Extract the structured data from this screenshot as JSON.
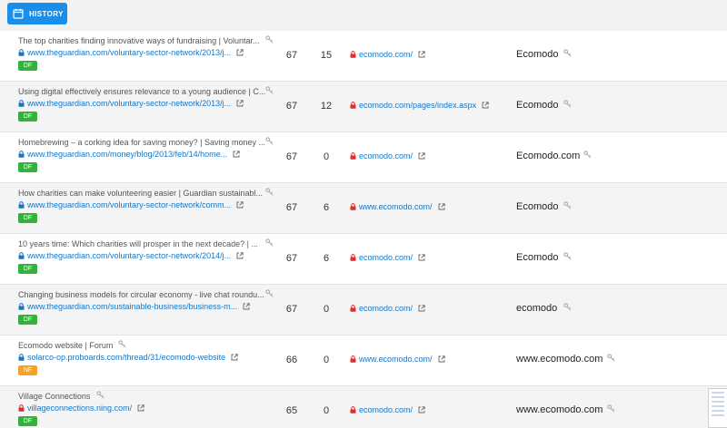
{
  "toolbar": {
    "history_label": "HISTORY"
  },
  "rows": [
    {
      "title": "The top charities finding innovative ways of fundraising | Voluntar...",
      "url": "www.theguardian.com/voluntary-sector-network/2013/j...",
      "badge": "DF",
      "n1": "67",
      "n2": "15",
      "target": "ecomodo.com/",
      "anchor": "Ecomodo"
    },
    {
      "title": "Using digital effectively ensures relevance to a young audience | C...",
      "url": "www.theguardian.com/voluntary-sector-network/2013/j...",
      "badge": "DF",
      "n1": "67",
      "n2": "12",
      "target": "ecomodo.com/pages/index.aspx",
      "anchor": "Ecomodo"
    },
    {
      "title": "Homebrewing – a corking idea for saving money? | Saving money ...",
      "url": "www.theguardian.com/money/blog/2013/feb/14/home...",
      "badge": "DF",
      "n1": "67",
      "n2": "0",
      "target": "ecomodo.com/",
      "anchor": "Ecomodo.com"
    },
    {
      "title": "How charities can make volunteering easier | Guardian sustainabl...",
      "url": "www.theguardian.com/voluntary-sector-network/comm...",
      "badge": "DF",
      "n1": "67",
      "n2": "6",
      "target": "www.ecomodo.com/",
      "anchor": "Ecomodo"
    },
    {
      "title": "10 years time: Which charities will prosper in the next decade? | ...",
      "url": "www.theguardian.com/voluntary-sector-network/2014/j...",
      "badge": "DF",
      "n1": "67",
      "n2": "6",
      "target": "ecomodo.com/",
      "anchor": "Ecomodo"
    },
    {
      "title": "Changing business models for circular economy - live chat roundu...",
      "url": "www.theguardian.com/sustainable-business/business-m...",
      "badge": "DF",
      "n1": "67",
      "n2": "0",
      "target": "ecomodo.com/",
      "anchor": "ecomodo"
    },
    {
      "title": "Ecomodo website | Forum",
      "url": "solarco-op.proboards.com/thread/31/ecomodo-website",
      "badge": "NF",
      "n1": "66",
      "n2": "0",
      "target": "www.ecomodo.com/",
      "anchor": "www.ecomodo.com"
    },
    {
      "title": "Village Connections",
      "url": "villageconnections.ning.com/",
      "badge": "DF",
      "n1": "65",
      "n2": "0",
      "target": "ecomodo.com/",
      "anchor": "www.ecomodo.com"
    }
  ],
  "colors": {
    "accent": "#1a8ee8",
    "link": "#1477c9",
    "df_badge": "#34b33c",
    "nf_badge": "#f4a22a",
    "lock_blue": "#1477c9",
    "lock_red": "#d9302c"
  },
  "icons": {
    "history": "calendar-icon",
    "source_lock": "lock-icon",
    "target_lock": "lock-icon",
    "external": "external-link-icon",
    "key": "key-icon"
  }
}
